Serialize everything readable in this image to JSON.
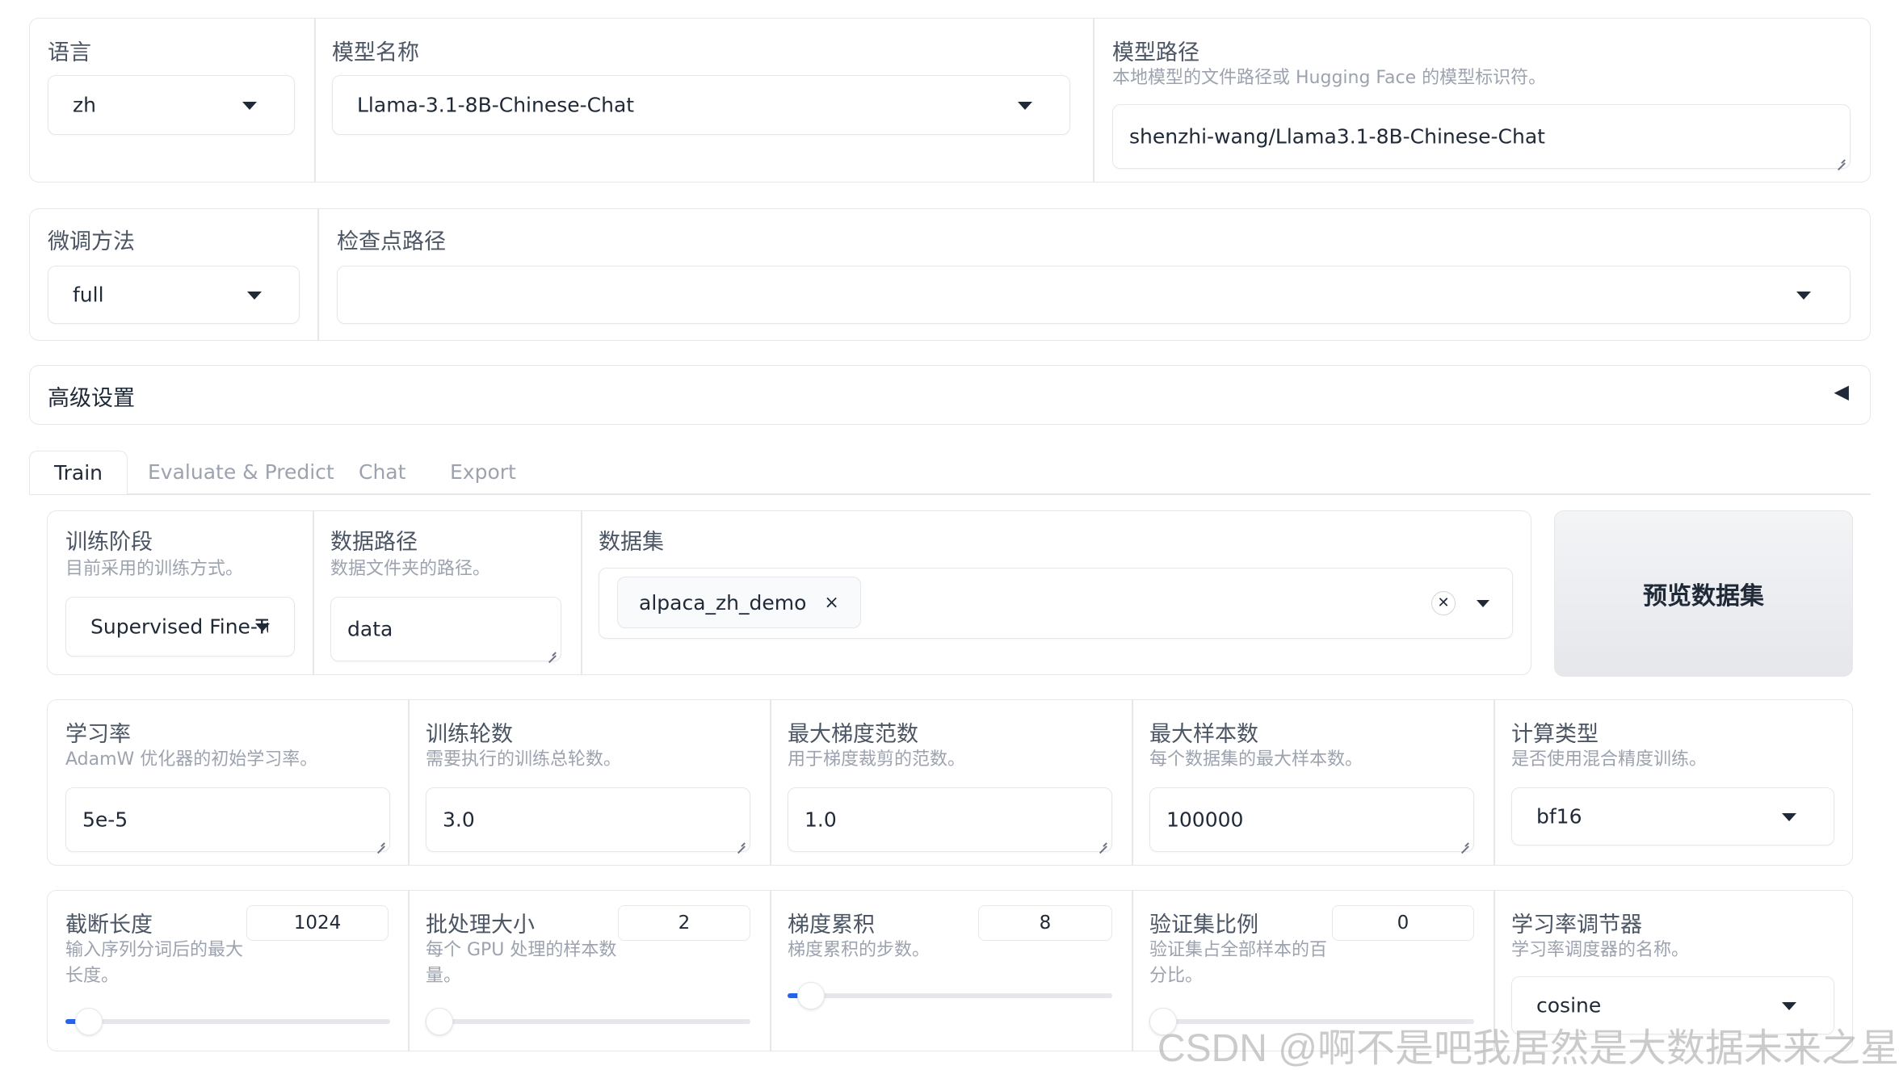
{
  "top": {
    "language": {
      "label": "语言",
      "value": "zh"
    },
    "model_name": {
      "label": "模型名称",
      "value": "Llama-3.1-8B-Chinese-Chat"
    },
    "model_path": {
      "label": "模型路径",
      "info": "本地模型的文件路径或 Hugging Face 的模型标识符。",
      "value": "shenzhi-wang/Llama3.1-8B-Chinese-Chat"
    }
  },
  "second": {
    "finetune": {
      "label": "微调方法",
      "value": "full"
    },
    "checkpoint": {
      "label": "检查点路径",
      "value": ""
    }
  },
  "advanced": {
    "label": "高级设置",
    "toggle_icon": "◀"
  },
  "tabs": [
    "Train",
    "Evaluate & Predict",
    "Chat",
    "Export"
  ],
  "train": {
    "stage": {
      "label": "训练阶段",
      "info": "目前采用的训练方式。",
      "value": "Supervised Fine-Tun"
    },
    "data_dir": {
      "label": "数据路径",
      "info": "数据文件夹的路径。",
      "value": "data"
    },
    "dataset": {
      "label": "数据集",
      "chip": "alpaca_zh_demo",
      "chip_remove": "×",
      "clear": "✕"
    },
    "preview_button": "预览数据集",
    "row1": [
      {
        "label": "学习率",
        "info": "AdamW 优化器的初始学习率。",
        "value": "5e-5"
      },
      {
        "label": "训练轮数",
        "info": "需要执行的训练总轮数。",
        "value": "3.0"
      },
      {
        "label": "最大梯度范数",
        "info": "用于梯度裁剪的范数。",
        "value": "1.0"
      },
      {
        "label": "最大样本数",
        "info": "每个数据集的最大样本数。",
        "value": "100000"
      },
      {
        "label": "计算类型",
        "info": "是否使用混合精度训练。",
        "value": "bf16"
      }
    ],
    "row2": [
      {
        "label": "截断长度",
        "info": "输入序列分词后的最大长度。",
        "value": "1024",
        "level": 0.03
      },
      {
        "label": "批处理大小",
        "info": "每个 GPU 处理的样本数量。",
        "value": "2",
        "level": 0.0
      },
      {
        "label": "梯度累积",
        "info": "梯度累积的步数。",
        "value": "8",
        "level": 0.03
      },
      {
        "label": "验证集比例",
        "info": "验证集占全部样本的百分比。",
        "value": "0",
        "level": 0.0
      },
      {
        "label": "学习率调节器",
        "info": "学习率调度器的名称。",
        "value": "cosine"
      }
    ]
  },
  "watermark": "CSDN @啊不是吧我居然是大数据未来之星"
}
